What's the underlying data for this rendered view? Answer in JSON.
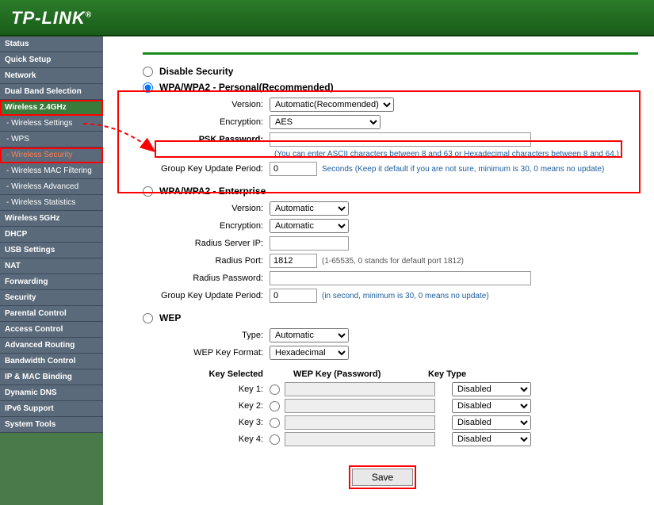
{
  "brand": "TP-LINK",
  "sidebar": {
    "items": [
      {
        "label": "Status"
      },
      {
        "label": "Quick Setup"
      },
      {
        "label": "Network"
      },
      {
        "label": "Dual Band Selection"
      },
      {
        "label": "Wireless 2.4GHz"
      },
      {
        "label": "- Wireless Settings"
      },
      {
        "label": "- WPS"
      },
      {
        "label": "- Wireless Security"
      },
      {
        "label": "- Wireless MAC Filtering"
      },
      {
        "label": "- Wireless Advanced"
      },
      {
        "label": "- Wireless Statistics"
      },
      {
        "label": "Wireless 5GHz"
      },
      {
        "label": "DHCP"
      },
      {
        "label": "USB Settings"
      },
      {
        "label": "NAT"
      },
      {
        "label": "Forwarding"
      },
      {
        "label": "Security"
      },
      {
        "label": "Parental Control"
      },
      {
        "label": "Access Control"
      },
      {
        "label": "Advanced Routing"
      },
      {
        "label": "Bandwidth Control"
      },
      {
        "label": "IP & MAC Binding"
      },
      {
        "label": "Dynamic DNS"
      },
      {
        "label": "IPv6 Support"
      },
      {
        "label": "System Tools"
      }
    ]
  },
  "security": {
    "disable_label": "Disable Security",
    "personal": {
      "title": "WPA/WPA2 - Personal(Recommended)",
      "version_label": "Version:",
      "version_value": "Automatic(Recommended)",
      "encryption_label": "Encryption:",
      "encryption_value": "AES",
      "psk_label": "PSK Password:",
      "psk_value": "",
      "psk_hint": "(You can enter ASCII characters between 8 and 63 or Hexadecimal characters between 8 and 64.)",
      "gkup_label": "Group Key Update Period:",
      "gkup_value": "0",
      "gkup_hint": "Seconds (Keep it default if you are not sure, minimum is 30, 0 means no update)"
    },
    "enterprise": {
      "title": "WPA/WPA2 - Enterprise",
      "version_label": "Version:",
      "version_value": "Automatic",
      "encryption_label": "Encryption:",
      "encryption_value": "Automatic",
      "radius_ip_label": "Radius Server IP:",
      "radius_ip_value": "",
      "radius_port_label": "Radius Port:",
      "radius_port_value": "1812",
      "radius_port_hint": "(1-65535, 0 stands for default port 1812)",
      "radius_pw_label": "Radius Password:",
      "radius_pw_value": "",
      "gkup_label": "Group Key Update Period:",
      "gkup_value": "0",
      "gkup_hint": "(in second, minimum is 30, 0 means no update)"
    },
    "wep": {
      "title": "WEP",
      "type_label": "Type:",
      "type_value": "Automatic",
      "format_label": "WEP Key Format:",
      "format_value": "Hexadecimal",
      "header_selected": "Key Selected",
      "header_key": "WEP Key (Password)",
      "header_type": "Key Type",
      "keys": [
        {
          "label": "Key 1:",
          "value": "",
          "type": "Disabled"
        },
        {
          "label": "Key 2:",
          "value": "",
          "type": "Disabled"
        },
        {
          "label": "Key 3:",
          "value": "",
          "type": "Disabled"
        },
        {
          "label": "Key 4:",
          "value": "",
          "type": "Disabled"
        }
      ]
    }
  },
  "save_label": "Save"
}
